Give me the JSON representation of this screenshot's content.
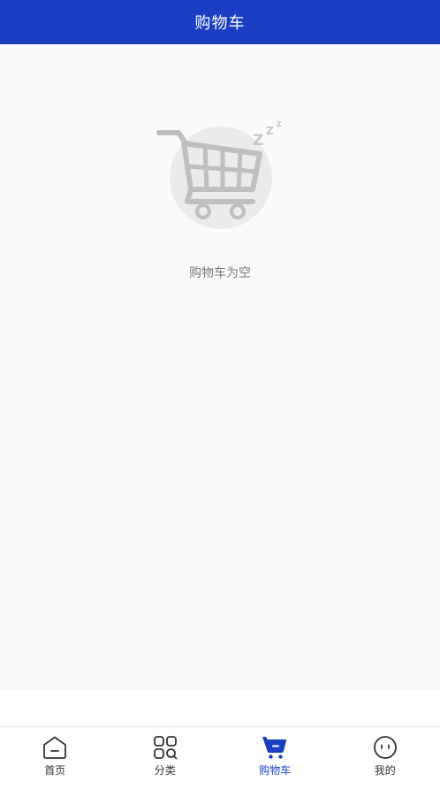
{
  "header": {
    "title": "购物车"
  },
  "empty_state": {
    "message": "购物车为空",
    "illustration_icon": "empty-cart-icon"
  },
  "tabbar": {
    "items": [
      {
        "label": "首页",
        "icon": "home-icon",
        "active": false
      },
      {
        "label": "分类",
        "icon": "category-icon",
        "active": false
      },
      {
        "label": "购物车",
        "icon": "cart-icon",
        "active": true
      },
      {
        "label": "我的",
        "icon": "profile-icon",
        "active": false
      }
    ]
  },
  "colors": {
    "brand": "#1a3fc4",
    "background": "#fafafa",
    "text_muted": "#7a7a7a",
    "tab_inactive": "#333333"
  }
}
